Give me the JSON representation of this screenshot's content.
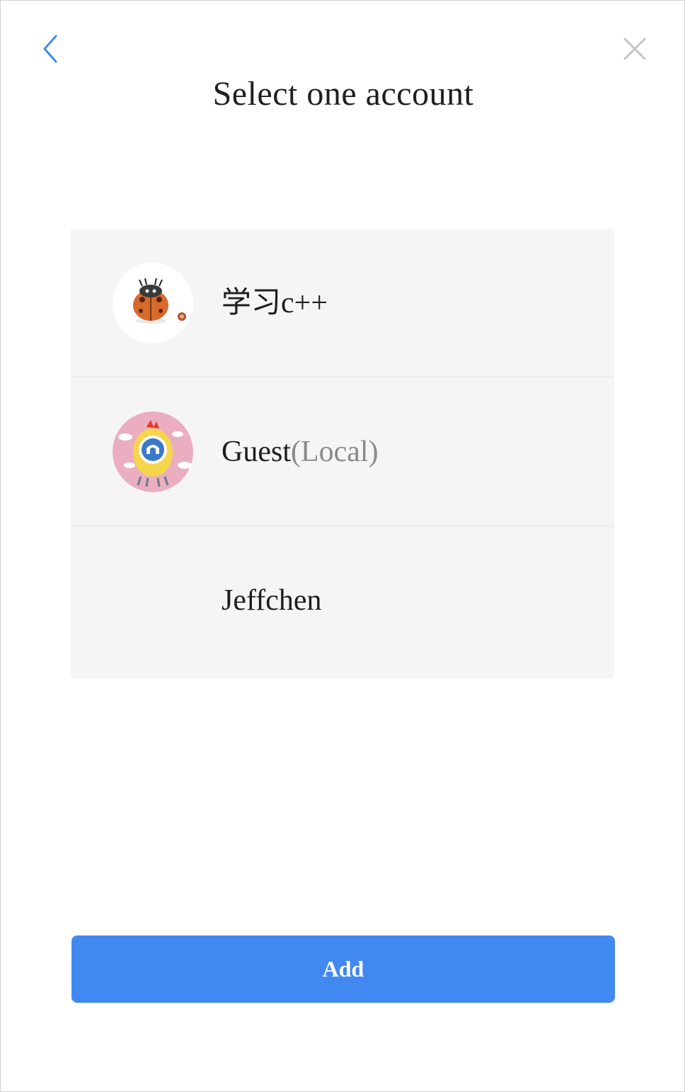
{
  "dialog": {
    "title": "Select one account",
    "back_icon": "chevron-left-icon",
    "close_icon": "close-icon",
    "accent_color": "#4189f1"
  },
  "accounts": [
    {
      "name": "学习c++",
      "tag": "",
      "avatar": "ladybug-avatar"
    },
    {
      "name": "Guest",
      "tag": "(Local)",
      "avatar": "chick-avatar"
    },
    {
      "name": "Jeffchen",
      "tag": "",
      "avatar": ""
    }
  ],
  "add_button": {
    "label": "Add"
  }
}
